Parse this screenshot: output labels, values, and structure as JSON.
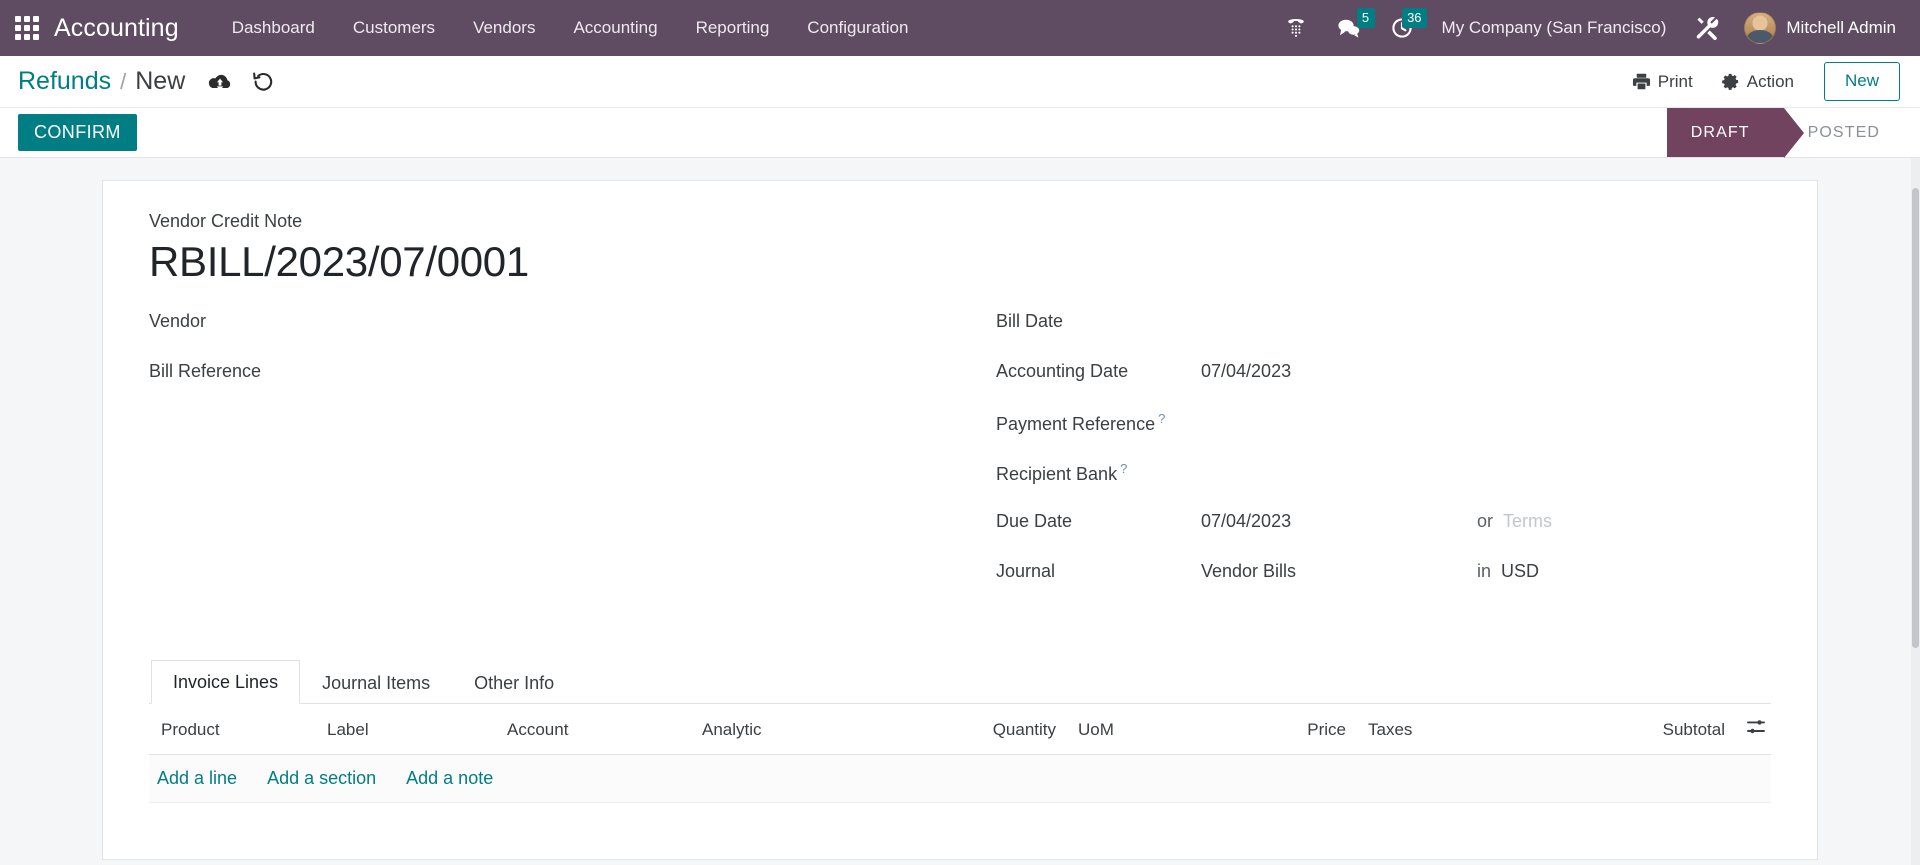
{
  "navbar": {
    "apps_icon": "apps-grid-icon",
    "brand": "Accounting",
    "menu": [
      {
        "label": "Dashboard"
      },
      {
        "label": "Customers"
      },
      {
        "label": "Vendors"
      },
      {
        "label": "Accounting"
      },
      {
        "label": "Reporting"
      },
      {
        "label": "Configuration"
      }
    ],
    "systray": {
      "voip_icon": "phone-dialpad-icon",
      "messages_icon": "chat-bubble-icon",
      "messages_count": "5",
      "activities_icon": "clock-icon",
      "activities_count": "36",
      "company": "My Company (San Francisco)",
      "debug_icon": "tools-icon",
      "avatar_icon": "user-avatar",
      "user": "Mitchell Admin"
    }
  },
  "control_panel": {
    "breadcrumb_parent": "Refunds",
    "breadcrumb_separator": "/",
    "breadcrumb_current": "New",
    "save_icon": "cloud-upload-icon",
    "discard_icon": "undo-rotate-icon",
    "print_label": "Print",
    "print_icon": "printer-icon",
    "action_label": "Action",
    "action_icon": "gear-icon",
    "new_label": "New"
  },
  "statusbar": {
    "confirm_label": "CONFIRM",
    "stages": [
      {
        "label": "DRAFT",
        "active": true
      },
      {
        "label": "POSTED",
        "active": false
      }
    ]
  },
  "form": {
    "doc_type_label": "Vendor Credit Note",
    "doc_number": "RBILL/2023/07/0001",
    "left_fields": [
      {
        "label": "Vendor",
        "value": "",
        "help": false
      },
      {
        "label": "Bill Reference",
        "value": "",
        "help": false
      }
    ],
    "right_fields": [
      {
        "label": "Bill Date",
        "value": "",
        "help": false,
        "suffix_label": "",
        "suffix_value": ""
      },
      {
        "label": "Accounting Date",
        "value": "07/04/2023",
        "help": false,
        "suffix_label": "",
        "suffix_value": ""
      },
      {
        "label": "Payment Reference",
        "value": "",
        "help": true,
        "suffix_label": "",
        "suffix_value": ""
      },
      {
        "label": "Recipient Bank",
        "value": "",
        "help": true,
        "suffix_label": "",
        "suffix_value": ""
      },
      {
        "label": "Due Date",
        "value": "07/04/2023",
        "help": false,
        "suffix_label": "or",
        "suffix_value": "Terms",
        "suffix_is_placeholder": true
      },
      {
        "label": "Journal",
        "value": "Vendor Bills",
        "help": false,
        "suffix_label": "in",
        "suffix_value": "USD",
        "suffix_is_placeholder": false
      }
    ],
    "help_marker": "?"
  },
  "notebook": {
    "tabs": [
      {
        "label": "Invoice Lines",
        "active": true
      },
      {
        "label": "Journal Items",
        "active": false
      },
      {
        "label": "Other Info",
        "active": false
      }
    ]
  },
  "lines": {
    "columns": [
      "Product",
      "Label",
      "Account",
      "Analytic",
      "Quantity",
      "UoM",
      "Price",
      "Taxes",
      "Subtotal"
    ],
    "optional_columns_icon": "sliders-toggle-icon",
    "rows": [],
    "add_links": [
      {
        "label": "Add a line"
      },
      {
        "label": "Add a section"
      },
      {
        "label": "Add a note"
      }
    ]
  },
  "colors": {
    "navbar_bg": "#5f4b62",
    "accent_teal": "#017e84",
    "stage_active_bg": "#71435f",
    "badge_bg": "#017e84",
    "sheet_bg": "#f5f6f7"
  }
}
